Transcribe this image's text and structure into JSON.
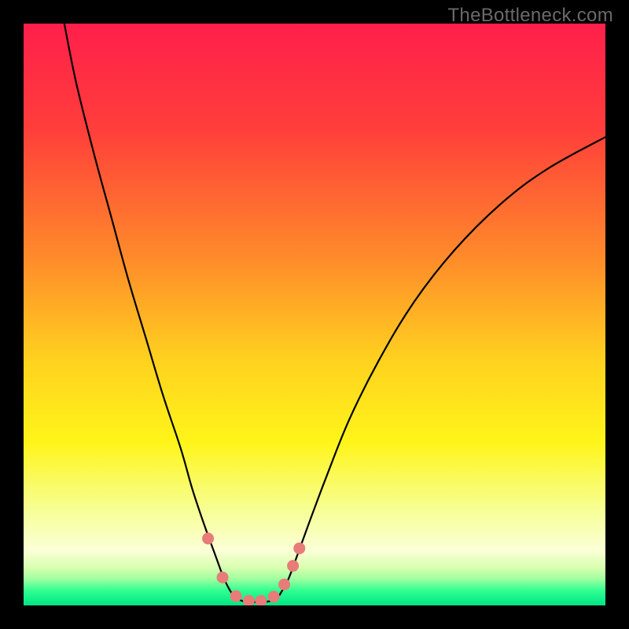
{
  "watermark": "TheBottleneck.com",
  "chart_data": {
    "type": "line",
    "title": "",
    "xlabel": "",
    "ylabel": "",
    "xlim": [
      0,
      100
    ],
    "ylim": [
      0,
      100
    ],
    "gradient_stops": [
      {
        "offset": 0.0,
        "color": "#ff1f4b"
      },
      {
        "offset": 0.18,
        "color": "#ff3e3b"
      },
      {
        "offset": 0.4,
        "color": "#ff8a2a"
      },
      {
        "offset": 0.58,
        "color": "#ffd21f"
      },
      {
        "offset": 0.72,
        "color": "#fff51a"
      },
      {
        "offset": 0.84,
        "color": "#f6ff99"
      },
      {
        "offset": 0.905,
        "color": "#fbffd6"
      },
      {
        "offset": 0.935,
        "color": "#d9ffb0"
      },
      {
        "offset": 0.955,
        "color": "#9effa0"
      },
      {
        "offset": 0.975,
        "color": "#2fff91"
      },
      {
        "offset": 1.0,
        "color": "#00e585"
      }
    ],
    "series": [
      {
        "name": "left-arm",
        "stroke": "#000000",
        "width": 2.2,
        "points": [
          {
            "x": 7.0,
            "y": 100.0
          },
          {
            "x": 9.0,
            "y": 90.0
          },
          {
            "x": 12.0,
            "y": 78.0
          },
          {
            "x": 15.0,
            "y": 67.0
          },
          {
            "x": 18.0,
            "y": 56.0
          },
          {
            "x": 21.0,
            "y": 46.0
          },
          {
            "x": 24.0,
            "y": 36.0
          },
          {
            "x": 27.0,
            "y": 27.0
          },
          {
            "x": 29.0,
            "y": 20.0
          },
          {
            "x": 31.0,
            "y": 14.0
          },
          {
            "x": 33.0,
            "y": 8.5
          },
          {
            "x": 34.5,
            "y": 4.5
          },
          {
            "x": 36.0,
            "y": 1.8
          },
          {
            "x": 37.5,
            "y": 0.8
          },
          {
            "x": 39.0,
            "y": 0.6
          },
          {
            "x": 41.0,
            "y": 0.6
          },
          {
            "x": 42.5,
            "y": 0.8
          },
          {
            "x": 44.0,
            "y": 1.8
          }
        ]
      },
      {
        "name": "right-arm",
        "stroke": "#000000",
        "width": 2.2,
        "points": [
          {
            "x": 44.0,
            "y": 1.8
          },
          {
            "x": 45.5,
            "y": 4.5
          },
          {
            "x": 47.0,
            "y": 8.5
          },
          {
            "x": 49.0,
            "y": 14.0
          },
          {
            "x": 52.0,
            "y": 22.0
          },
          {
            "x": 56.0,
            "y": 32.0
          },
          {
            "x": 61.0,
            "y": 42.0
          },
          {
            "x": 67.0,
            "y": 52.0
          },
          {
            "x": 74.0,
            "y": 61.0
          },
          {
            "x": 82.0,
            "y": 69.0
          },
          {
            "x": 90.0,
            "y": 75.0
          },
          {
            "x": 100.0,
            "y": 80.5
          }
        ]
      }
    ],
    "markers": {
      "color": "#e77c78",
      "radius": 7.5,
      "points": [
        {
          "x": 31.7,
          "y": 11.5
        },
        {
          "x": 34.2,
          "y": 4.8
        },
        {
          "x": 36.5,
          "y": 1.6
        },
        {
          "x": 38.7,
          "y": 0.8
        },
        {
          "x": 40.8,
          "y": 0.8
        },
        {
          "x": 43.0,
          "y": 1.5
        },
        {
          "x": 44.8,
          "y": 3.6
        },
        {
          "x": 46.3,
          "y": 6.8
        },
        {
          "x": 47.4,
          "y": 9.8
        }
      ]
    }
  }
}
